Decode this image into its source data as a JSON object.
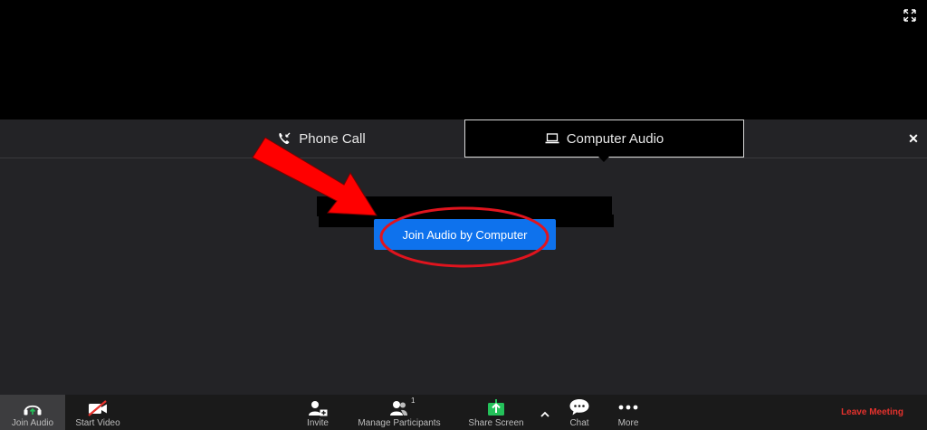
{
  "audio_panel": {
    "tabs": [
      {
        "label": "Phone Call",
        "icon": "phone-icon",
        "selected": false
      },
      {
        "label": "Computer Audio",
        "icon": "laptop-icon",
        "selected": true
      }
    ],
    "join_button_label": "Join Audio by Computer"
  },
  "toolbar": {
    "join_audio": "Join Audio",
    "start_video": "Start Video",
    "invite": "Invite",
    "manage_participants": "Manage Participants",
    "participant_count": "1",
    "share_screen": "Share Screen",
    "chat": "Chat",
    "more": "More",
    "leave_meeting": "Leave Meeting"
  },
  "colors": {
    "panel_bg": "#232326",
    "toolbar_bg": "#1a1a1a",
    "button_blue": "#0e72ed",
    "share_green": "#24c15a",
    "leave_red": "#e5322d",
    "annotation_red": "#ff0000"
  }
}
